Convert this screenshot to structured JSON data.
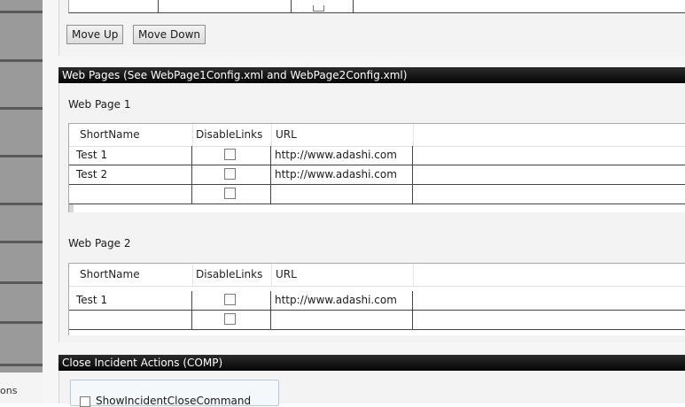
{
  "sidebar": {
    "partial_label": "ons"
  },
  "buttons": {
    "move_up": "Move Up",
    "move_down": "Move Down"
  },
  "web_pages_section": {
    "header": "Web Pages (See WebPage1Config.xml and WebPage2Config.xml)",
    "columns": [
      "ShortName",
      "DisableLinks",
      "URL"
    ],
    "page1": {
      "title": "Web Page 1",
      "rows": [
        {
          "short_name": "Test 1",
          "disable_links": false,
          "url": "http://www.adashi.com"
        },
        {
          "short_name": "Test 2",
          "disable_links": false,
          "url": "http://www.adashi.com"
        },
        {
          "short_name": "",
          "disable_links": false,
          "url": ""
        }
      ]
    },
    "page2": {
      "title": "Web Page 2",
      "rows": [
        {
          "short_name": "Test 1",
          "disable_links": false,
          "url": "http://www.adashi.com"
        },
        {
          "short_name": "",
          "disable_links": false,
          "url": ""
        }
      ]
    }
  },
  "close_incident_section": {
    "header": "Close Incident Actions (COMP)",
    "checkbox_label": "ShowIncidentCloseCommand",
    "checked": false
  }
}
